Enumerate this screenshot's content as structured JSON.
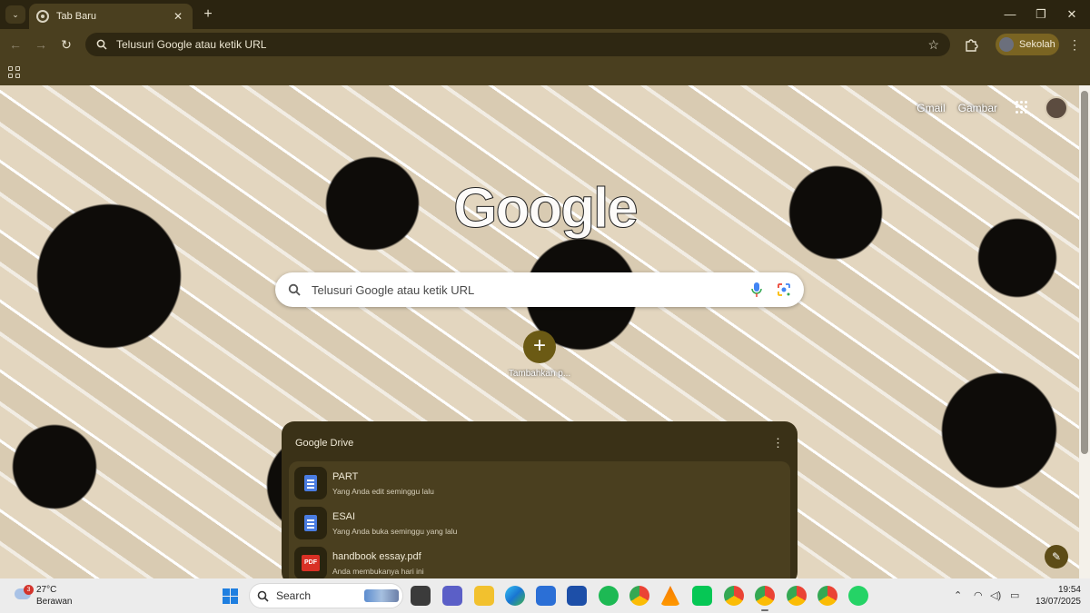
{
  "browser": {
    "tab": {
      "title": "Tab Baru"
    },
    "omnibox": {
      "placeholder": "Telusuri Google atau ketik URL"
    },
    "profile": {
      "name": "Sekolah"
    },
    "window_controls": {
      "minimize": "—",
      "restore": "❐",
      "close": "✕"
    }
  },
  "ntp": {
    "top_links": {
      "gmail": "Gmail",
      "images": "Gambar"
    },
    "logo": "Google",
    "search": {
      "placeholder": "Telusuri Google atau ketik URL"
    },
    "shortcut": {
      "label": "Tambahkan p...",
      "symbol": "+"
    },
    "drive": {
      "title": "Google Drive",
      "files": [
        {
          "name": "PART",
          "subtitle": "Yang Anda edit seminggu lalu",
          "type": "doc"
        },
        {
          "name": "ESAI",
          "subtitle": "Yang Anda buka seminggu yang lalu",
          "type": "doc"
        },
        {
          "name": "handbook essay.pdf",
          "subtitle": "Anda membukanya hari ini",
          "type": "pdf",
          "badge": "PDF"
        }
      ]
    }
  },
  "taskbar": {
    "weather": {
      "temp": "27°C",
      "desc": "Berawan",
      "badge": "3"
    },
    "search": {
      "label": "Search"
    },
    "apps": [
      "file-explorer-widget",
      "teams",
      "file-explorer",
      "edge",
      "store",
      "editor",
      "spotify",
      "chrome",
      "vlc",
      "line",
      "chrome-profile-1",
      "chrome-profile-2",
      "chrome-profile-3",
      "chrome-profile-4",
      "whatsapp"
    ],
    "clock": {
      "time": "19:54",
      "date": "13/07/2025"
    }
  },
  "colors": {
    "frame": "#2b2410",
    "toolbar": "#4a3f1f",
    "accent": "#6b5a14",
    "card": "#3a3117"
  }
}
